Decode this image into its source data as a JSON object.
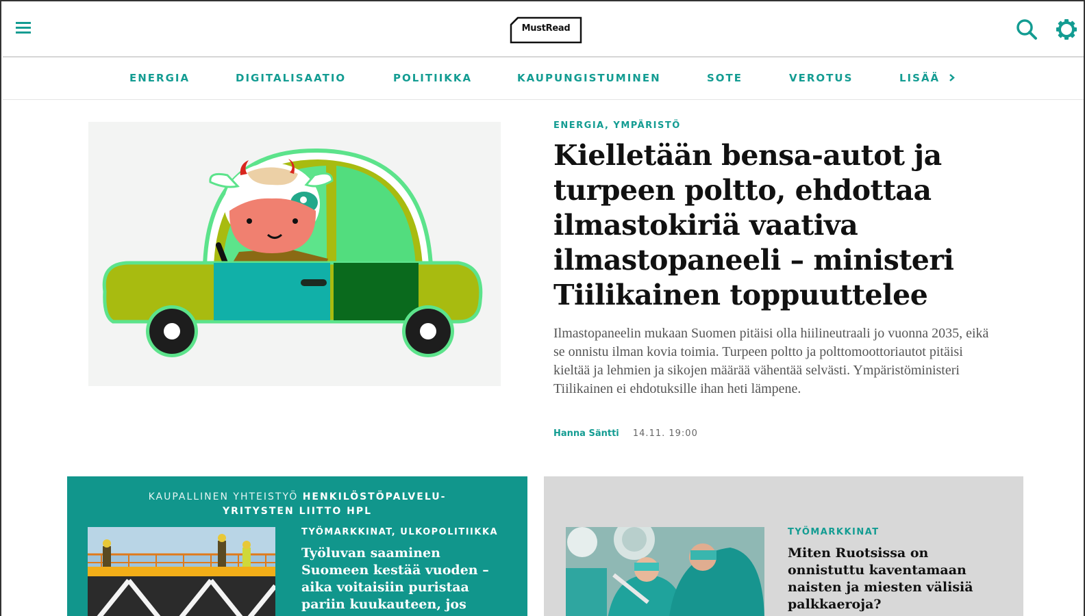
{
  "header": {
    "logo_text": "MustRead",
    "menu_icon": "hamburger-menu-icon",
    "search_icon": "search-icon",
    "settings_icon": "settings-icon"
  },
  "nav": {
    "items": [
      "ENERGIA",
      "DIGITALISAATIO",
      "POLITIIKKA",
      "KAUPUNGISTUMINEN",
      "SOTE",
      "VEROTUS",
      "LISÄÄ"
    ],
    "more_icon": "chevron-right-icon"
  },
  "hero": {
    "tags": "ENERGIA, YMPÄRISTÖ",
    "title": "Kielletään bensa-autot ja turpeen poltto, ehdottaa ilmastokiriä vaativa ilmastopaneeli – ministeri Tiilikainen toppuuttelee",
    "lead": "Ilmastopaneelin mukaan Suomen pitäisi olla hiilineutraali jo vuonna 2035, eikä se onnistu ilman kovia toimia. Turpeen poltto ja polttomoottoriautot pitäisi kieltää ja lehmien ja sikojen määrää vähentää selvästi. Ympäristöministeri Tiilikainen ei ehdotuksille ihan heti lämpene.",
    "author": "Hanna Säntti",
    "time": "14.11. 19:00",
    "image": "cow-driving-car-illustration"
  },
  "cards": [
    {
      "sponsor_prefix": "KAUPALLINEN YHTEISTYÖ",
      "sponsor_line1": "HENKILÖSTÖPALVELU-",
      "sponsor_line2": "YRITYSTEN LIITTO HPL",
      "tags": "TYÖMARKKINAT, ULKOPOLITIIKKA",
      "title": "Työluvan saaminen Suomeen kestää vuoden – aika voitaisiin puristaa pariin kuukauteen, jos",
      "image": "construction-workers-photo",
      "bg_color": "#11968c"
    },
    {
      "tags": "TYÖMARKKINAT",
      "title": "Miten Ruotsissa on onnistuttu kaventamaan naisten ja miesten välisiä palkkaeroja?",
      "image": "surgeons-operating-room-photo",
      "bg_color": "#d8d8d8"
    }
  ],
  "colors": {
    "accent": "#139c92",
    "text": "#111111"
  }
}
